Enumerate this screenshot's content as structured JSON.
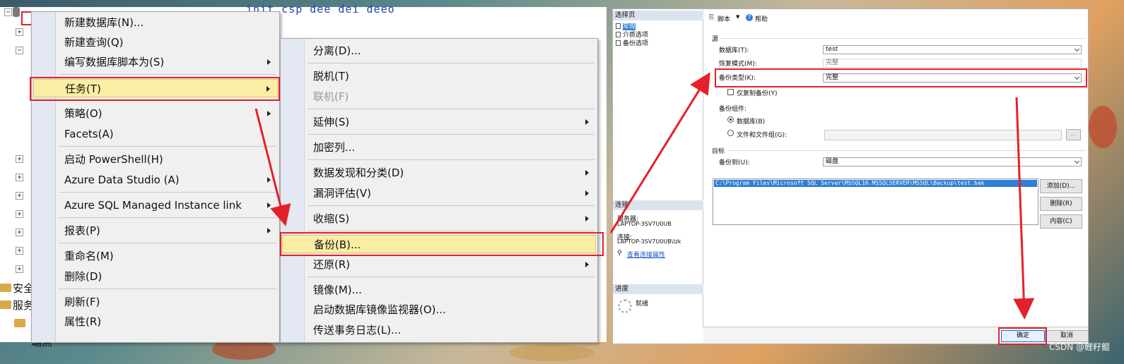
{
  "explorer": {
    "query_fragment": "init csp dee dei deeo",
    "labels": [
      "安全",
      "服务",
      "端点"
    ]
  },
  "menu1": {
    "items": [
      {
        "label": "新建数据库(N)..."
      },
      {
        "label": "新建查询(Q)"
      },
      {
        "label": "编写数据库脚本为(S)"
      },
      {
        "label": "任务(T)"
      },
      {
        "label": "策略(O)"
      },
      {
        "label": "Facets(A)"
      },
      {
        "label": "启动 PowerShell(H)"
      },
      {
        "label": "Azure Data Studio (A)"
      },
      {
        "label": "Azure SQL Managed Instance link"
      },
      {
        "label": "报表(P)"
      },
      {
        "label": "重命名(M)"
      },
      {
        "label": "删除(D)"
      },
      {
        "label": "刷新(F)"
      },
      {
        "label": "属性(R)"
      }
    ]
  },
  "menu2": {
    "items": [
      {
        "label": "分离(D)..."
      },
      {
        "label": "脱机(T)"
      },
      {
        "label": "联机(F)"
      },
      {
        "label": "延伸(S)"
      },
      {
        "label": "加密列..."
      },
      {
        "label": "数据发现和分类(D)"
      },
      {
        "label": "漏洞评估(V)"
      },
      {
        "label": "收缩(S)"
      },
      {
        "label": "备份(B)..."
      },
      {
        "label": "还原(R)"
      },
      {
        "label": "镜像(M)..."
      },
      {
        "label": "启动数据库镜像监视器(O)..."
      },
      {
        "label": "传送事务日志(L)..."
      }
    ]
  },
  "dialog": {
    "select_page": "选择页",
    "pages": [
      "常规",
      "介质选项",
      "备份选项"
    ],
    "toolbar_script": "脚本",
    "toolbar_help": "帮助",
    "section_source": "源",
    "database_label": "数据库(T):",
    "database_value": "test",
    "recovery_label": "恢复模式(M):",
    "recovery_value": "完整",
    "backup_type_label": "备份类型(K):",
    "backup_type_value": "完整",
    "copy_only": "仅复制备份(Y)",
    "backup_component": "备份组件:",
    "radio_database": "数据库(B)",
    "radio_files": "文件和文件组(G):",
    "browse": "...",
    "section_target": "目标",
    "backup_to_label": "备份到(U):",
    "backup_to_value": "磁盘",
    "dest_path": "C:\\Program Files\\Microsoft SQL Server\\MSSQL16.MSSQLSERVER\\MSSQL\\Backup\\test.bak",
    "btn_add": "添加(D)...",
    "btn_remove": "删除(R)",
    "btn_contents": "内容(C)",
    "conn_head": "连接",
    "server_label": "服务器:",
    "server_value": "LAPTOP-3SV7U0UB",
    "conn_label": "连接:",
    "conn_value": "LAPTOP-3SV7U0UB\\lzk",
    "conn_props": "查看连接属性",
    "progress_head": "进度",
    "progress_status": "就绪",
    "ok": "确定",
    "cancel": "取消"
  },
  "watermark": "CSDN @鲤籽鲲",
  "accent_red": "#e5202a",
  "highlight_yellow": "#fbeea4"
}
